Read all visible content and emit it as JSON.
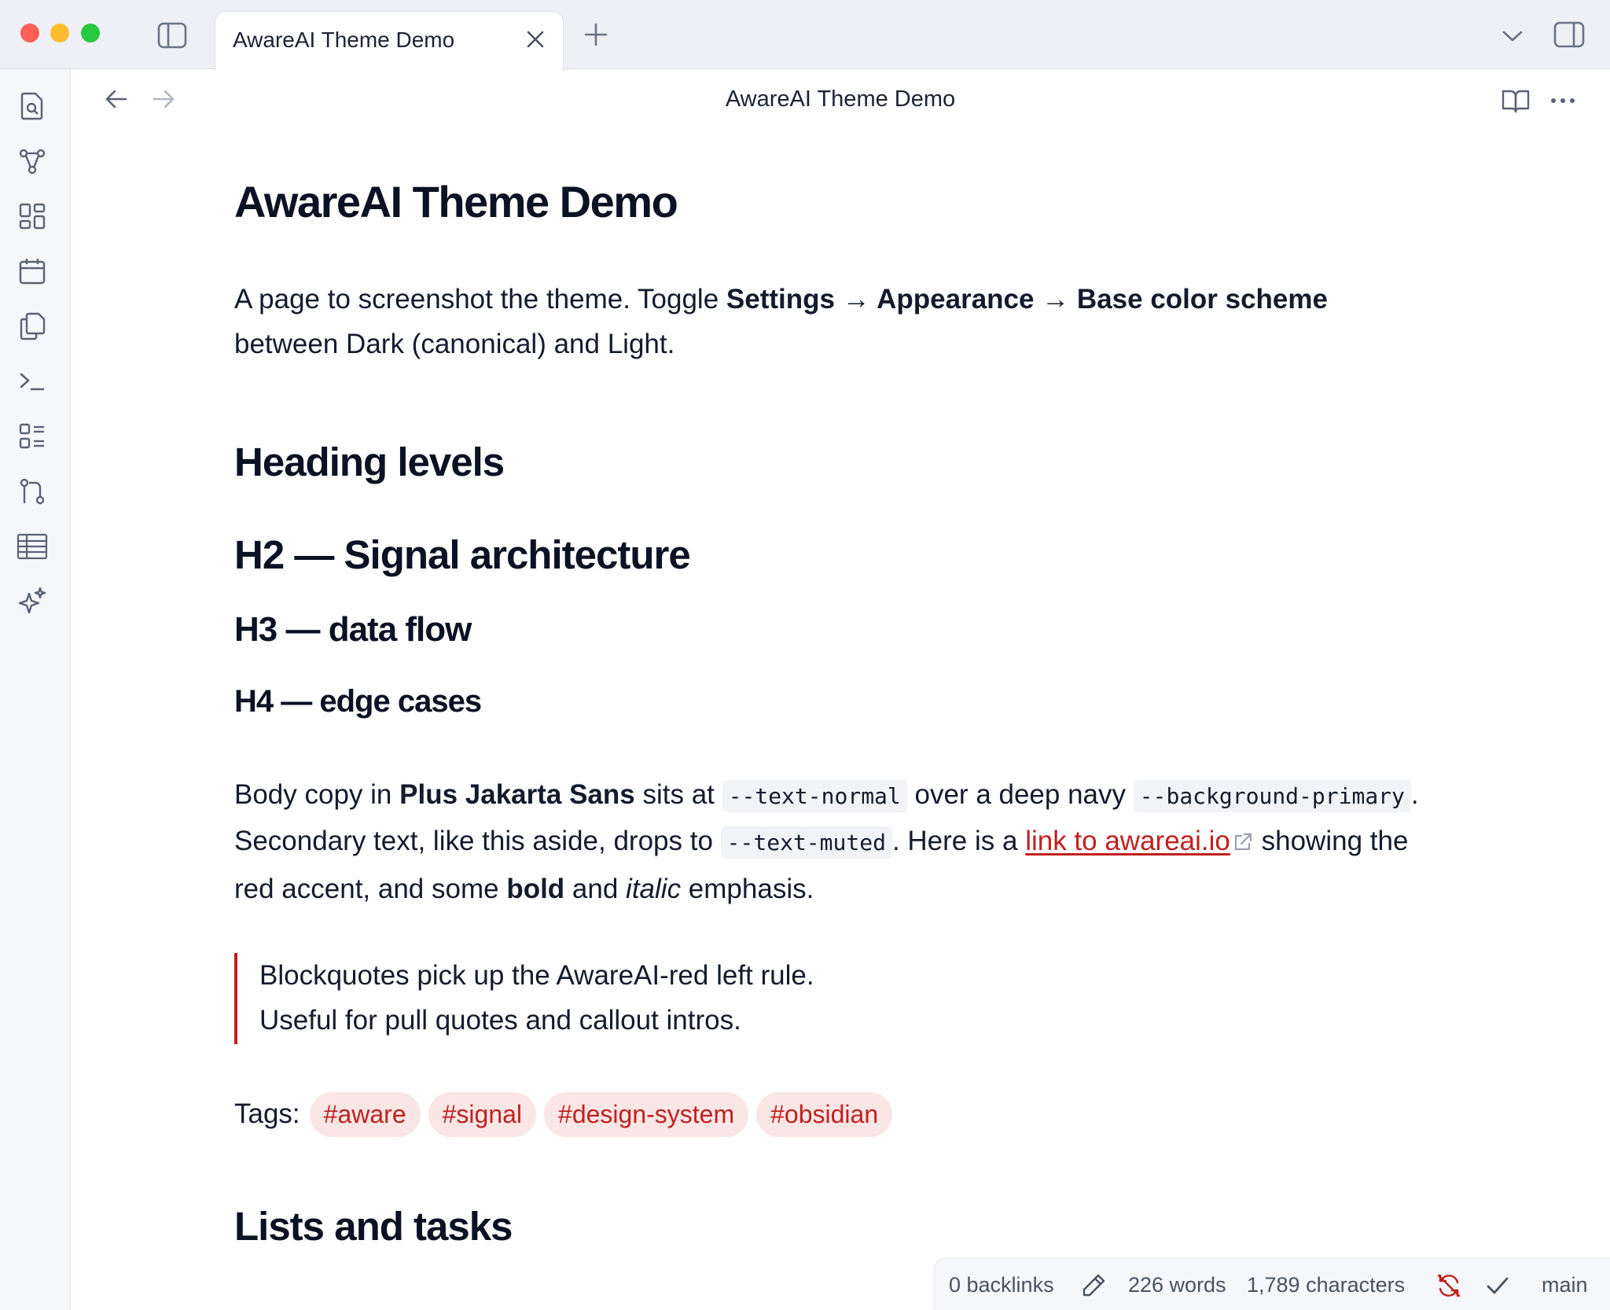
{
  "window": {
    "tab_title": "AwareAI Theme Demo"
  },
  "header": {
    "title": "AwareAI Theme Demo"
  },
  "ribbon": {
    "icons": [
      "search-file-icon",
      "graph-icon",
      "dashboard-icon",
      "calendar-icon",
      "copy-icon",
      "terminal-icon",
      "checklist-icon",
      "git-branch-icon",
      "table-icon",
      "sparkles-icon"
    ]
  },
  "note": {
    "title": "AwareAI Theme Demo",
    "intro": {
      "t1": "A page to screenshot the theme. Toggle ",
      "b1": "Settings → Appearance → Base color scheme",
      "t2": "between Dark (canonical) and Light."
    },
    "heading_levels": "Heading levels",
    "h2": "H2 — Signal architecture",
    "h3": "H3 — data flow",
    "h4": "H4 — edge cases",
    "body": {
      "t1": "Body copy in ",
      "b1": "Plus Jakarta Sans",
      "t2": " sits at ",
      "c1": "--text-normal",
      "t3": " over a deep navy ",
      "c2": "--background-primary",
      "t4": ".",
      "t5": "Secondary text, like this aside, drops to ",
      "c3": "--text-muted",
      "t6": ". Here is a ",
      "link": "link to awareai.io",
      "t7": " showing the",
      "t8": "red accent, and some ",
      "b2": "bold",
      "t9": " and ",
      "i1": "italic",
      "t10": " emphasis."
    },
    "quote": {
      "line1": "Blockquotes pick up the AwareAI-red left rule.",
      "line2": "Useful for pull quotes and callout intros."
    },
    "tags_label": "Tags:",
    "tags": [
      "#aware",
      "#signal",
      "#design-system",
      "#obsidian"
    ],
    "lists_heading": "Lists and tasks"
  },
  "status": {
    "backlinks": "0 backlinks",
    "words": "226 words",
    "characters": "1,789 characters",
    "branch": "main"
  },
  "colors": {
    "accent": "#c0201f",
    "tag_bg": "#fbe6e6"
  }
}
